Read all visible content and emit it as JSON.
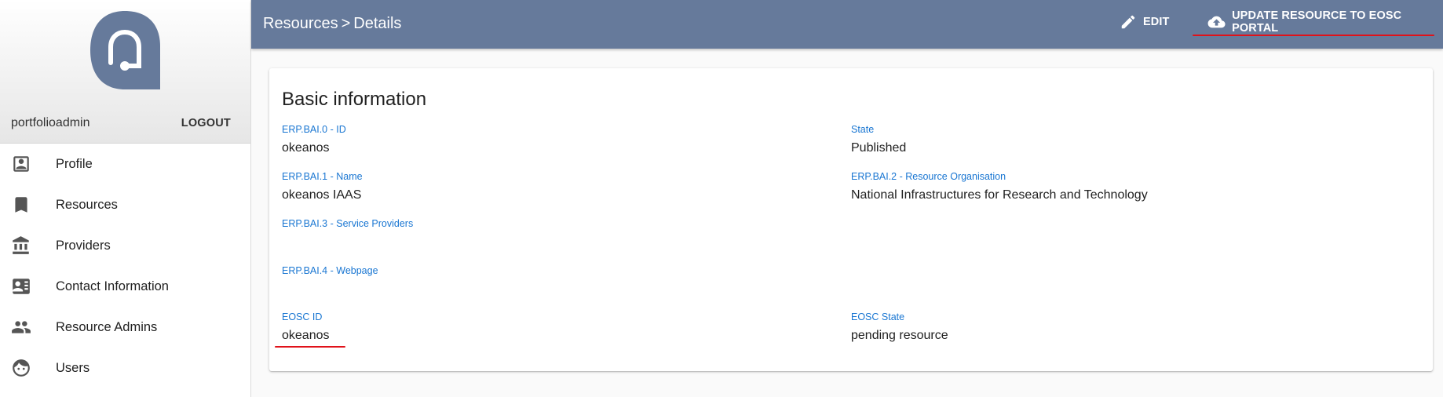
{
  "sidebar": {
    "username": "portfolioadmin",
    "logout_label": "LOGOUT",
    "logo_icon": "portal-logo-icon",
    "items": [
      {
        "label": "Profile",
        "icon": "profile-icon"
      },
      {
        "label": "Resources",
        "icon": "bookmark-icon"
      },
      {
        "label": "Providers",
        "icon": "bank-icon"
      },
      {
        "label": "Contact Information",
        "icon": "contact-card-icon"
      },
      {
        "label": "Resource Admins",
        "icon": "people-icon"
      },
      {
        "label": "Users",
        "icon": "face-icon"
      }
    ]
  },
  "header": {
    "breadcrumb": [
      "Resources",
      "Details"
    ],
    "separator": ">",
    "edit_label": "EDIT",
    "update_label": "UPDATE RESOURCE TO EOSC PORTAL",
    "background": "#667a9b"
  },
  "card": {
    "title": "Basic information",
    "fields": [
      {
        "label": "ERP.BAI.0 - ID",
        "value": "okeanos"
      },
      {
        "label": "State",
        "value": "Published"
      },
      {
        "label": "ERP.BAI.1 - Name",
        "value": "okeanos IAAS"
      },
      {
        "label": "ERP.BAI.2 - Resource Organisation",
        "value": "National Infrastructures for Research and Technology"
      },
      {
        "label": "ERP.BAI.3 - Service Providers",
        "value": ""
      },
      {
        "label": "ERP.BAI.4 - Webpage",
        "value": ""
      },
      {
        "label": "EOSC ID",
        "value": "okeanos"
      },
      {
        "label": "EOSC State",
        "value": "pending resource"
      }
    ]
  },
  "colors": {
    "label_blue": "#1976d2",
    "annotation_red": "#e0121a"
  }
}
